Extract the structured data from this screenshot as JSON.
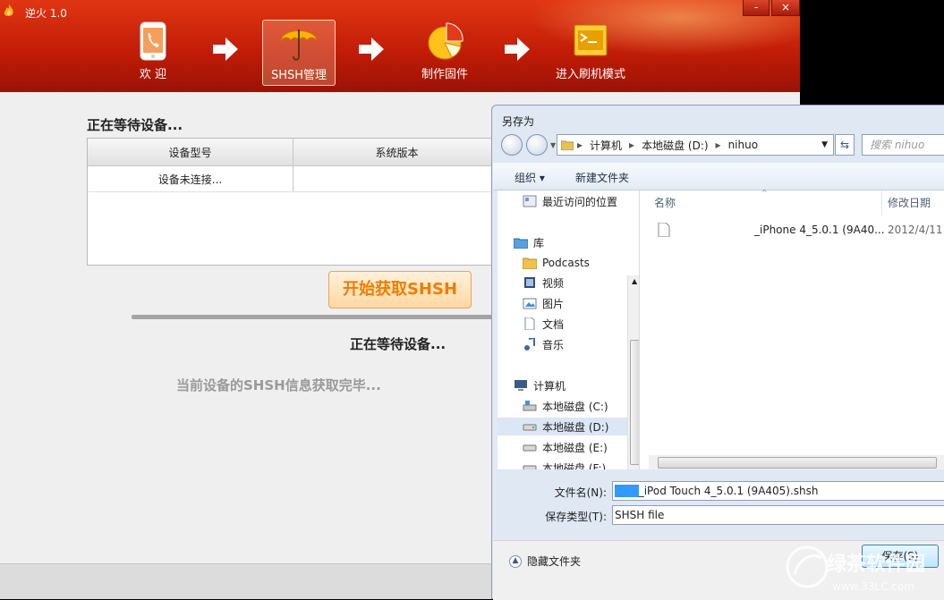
{
  "app": {
    "title": "逆火 1.0",
    "window_controls": {
      "minimize": "-",
      "close": "×"
    },
    "nav": [
      {
        "label": "欢 迎",
        "icon": "phone-icon"
      },
      {
        "label": "SHSH管理",
        "icon": "umbrella-icon",
        "active": true
      },
      {
        "label": "制作固件",
        "icon": "pie-chart-icon"
      },
      {
        "label": "进入刷机模式",
        "icon": "terminal-icon"
      }
    ],
    "main": {
      "waiting_title": "正在等待设备...",
      "table": {
        "headers": [
          "设备型号",
          "系统版本"
        ],
        "rows": [
          [
            "设备未连接...",
            ""
          ]
        ]
      },
      "start_button": "开始获取SHSH",
      "status_waiting": "正在等待设备...",
      "status_done": "当前设备的SHSH信息获取完毕..."
    }
  },
  "dialog": {
    "title": "另存为",
    "address": {
      "items": [
        "计算机",
        "本地磁盘 (D:)",
        "nihuo"
      ]
    },
    "search_placeholder": "搜索 nihuo",
    "toolbar": {
      "organize": "组织 ▾",
      "new_folder": "新建文件夹"
    },
    "tree": [
      {
        "label": "最近访问的位置",
        "icon": "recent-places-icon"
      },
      {
        "label": "库",
        "icon": "library-icon"
      },
      {
        "label": "Podcasts",
        "icon": "folder-icon"
      },
      {
        "label": "视频",
        "icon": "video-icon"
      },
      {
        "label": "图片",
        "icon": "picture-icon"
      },
      {
        "label": "文档",
        "icon": "document-icon"
      },
      {
        "label": "音乐",
        "icon": "music-icon"
      },
      {
        "label": "计算机",
        "icon": "computer-icon"
      },
      {
        "label": "本地磁盘 (C:)",
        "icon": "drive-c-icon"
      },
      {
        "label": "本地磁盘 (D:)",
        "icon": "drive-icon",
        "selected": true
      },
      {
        "label": "本地磁盘 (E:)",
        "icon": "drive-icon"
      },
      {
        "label": "本地磁盘 (F:)",
        "icon": "drive-icon"
      }
    ],
    "columns": {
      "name": "名称",
      "modified": "修改日期"
    },
    "files": [
      {
        "name": "_iPhone 4_5.0.1 (9A40...",
        "date": "2012/4/11"
      }
    ],
    "filename_label": "文件名(N):",
    "filename_value": "_iPod Touch 4_5.0.1 (9A405).shsh",
    "filename_highlight": "1          30",
    "filetype_label": "保存类型(T):",
    "filetype_value": "SHSH file",
    "hide_folders": "隐藏文件夹",
    "save_button": "保存(S)"
  },
  "watermark": {
    "brand": "绿茶软件园",
    "url": "www.33LC.com"
  },
  "colors": {
    "header_red": "#c21d07",
    "start_button_text": "#f07d00",
    "dialog_bg": "#dfe8f3"
  }
}
